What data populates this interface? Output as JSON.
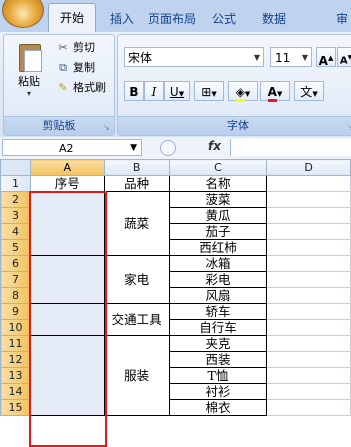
{
  "ribbon": {
    "tabs": [
      "开始",
      "插入",
      "页面布局",
      "公式",
      "数据",
      "审"
    ],
    "active_tab": "开始",
    "clipboard": {
      "paste_label": "粘贴",
      "cut_label": "剪切",
      "copy_label": "复制",
      "format_painter_label": "格式刷",
      "group_label": "剪贴板"
    },
    "font": {
      "font_name": "宋体",
      "font_size": "11",
      "bold": "B",
      "italic": "I",
      "underline": "U",
      "grow": "A",
      "shrink": "A",
      "font_color_glyph": "A",
      "phonetic_glyph": "文",
      "group_label": "字体"
    }
  },
  "formula_bar": {
    "name_box": "A2",
    "fx_label": "fx",
    "formula": ""
  },
  "sheet": {
    "columns": [
      "A",
      "B",
      "C",
      "D"
    ],
    "rows": [
      "1",
      "2",
      "3",
      "4",
      "5",
      "6",
      "7",
      "8",
      "9",
      "10",
      "11",
      "12",
      "13",
      "14",
      "15"
    ],
    "headers": [
      "序号",
      "品种",
      "名称"
    ],
    "groups": [
      {
        "category": "蔬菜",
        "items": [
          "菠菜",
          "黄瓜",
          "茄子",
          "西红柿"
        ]
      },
      {
        "category": "家电",
        "items": [
          "冰箱",
          "彩电",
          "风扇"
        ]
      },
      {
        "category": "交通工具",
        "items": [
          "轿车",
          "自行车"
        ]
      },
      {
        "category": "服装",
        "items": [
          "夹克",
          "西装",
          "T恤",
          "衬衫",
          "棉衣"
        ]
      }
    ]
  },
  "colors": {
    "highlight_border": "#e31a1c",
    "ribbon_text": "#15428b"
  }
}
